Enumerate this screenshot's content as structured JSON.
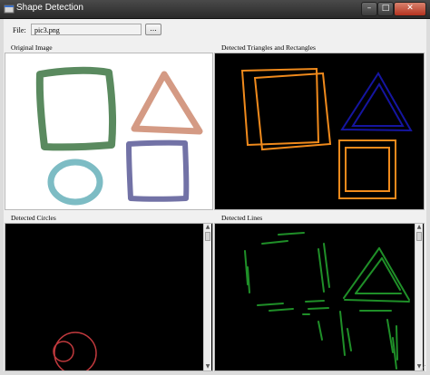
{
  "window": {
    "title": "Shape Detection",
    "minimize_glyph": "–",
    "maximize_glyph": "□",
    "close_glyph": "✕"
  },
  "file": {
    "label": "File:",
    "value": "pic3.png",
    "browse_label": "..."
  },
  "panels": {
    "original": "Original Image",
    "triangles_rectangles": "Detected Triangles and  Rectangles",
    "circles": "Detected Circles",
    "lines": "Detected Lines"
  },
  "scrollbar": {
    "up_glyph": "▲",
    "down_glyph": "▼"
  },
  "colors": {
    "titlebar": "#2f2f2f",
    "square_green": "#5a8a5f",
    "triangle_salmon": "#d49a84",
    "circle_teal": "#7dbcc4",
    "square_purple": "#7272a6",
    "triangle_detected": "#1515a0",
    "rectangle_detected": "#f08a1c",
    "circle_detected": "#c0393d",
    "line_detected": "#1f8f28"
  }
}
